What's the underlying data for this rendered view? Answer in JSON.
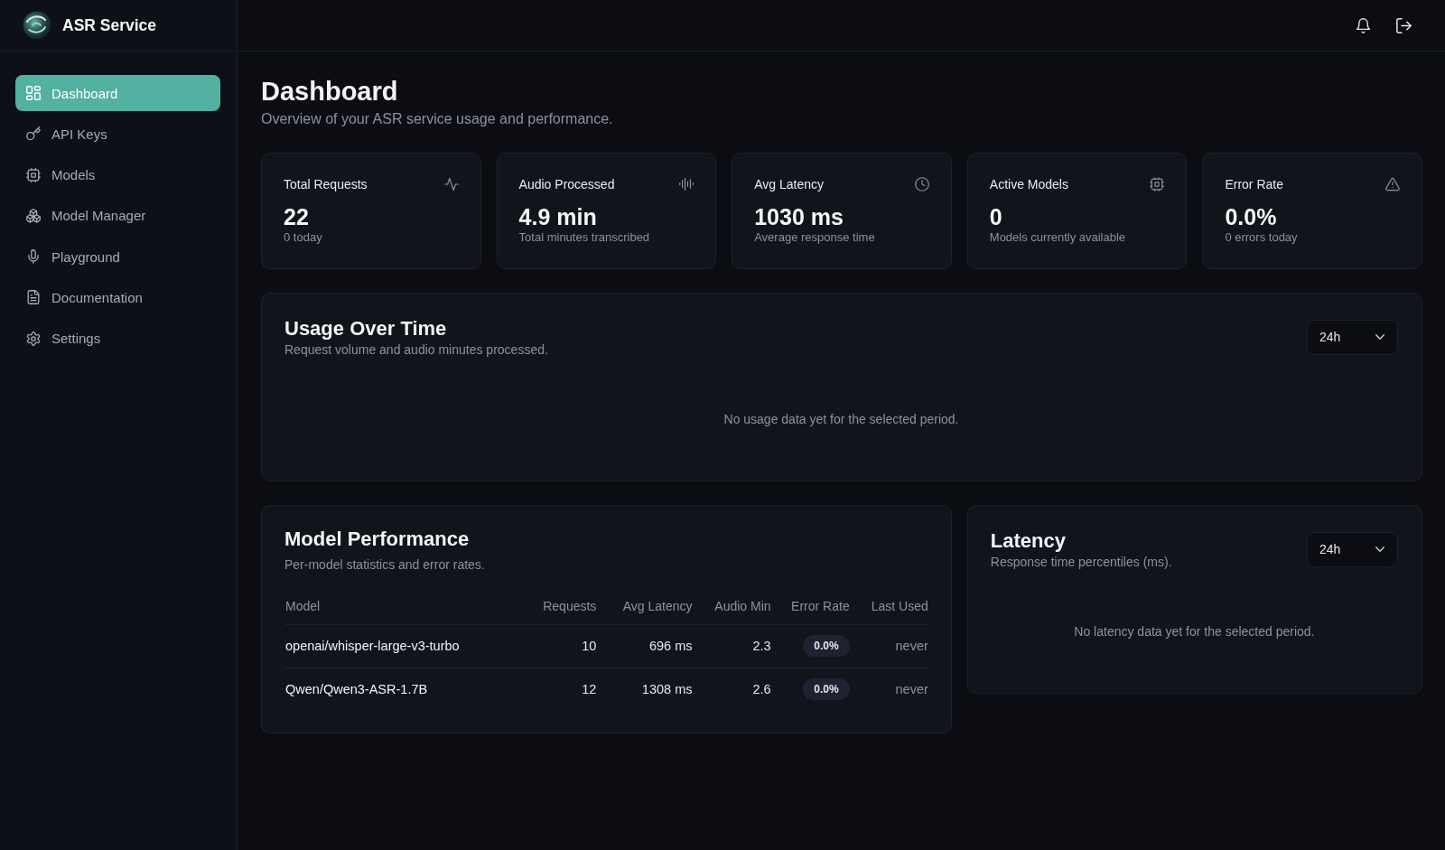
{
  "sidebar": {
    "brand": "ASR Service",
    "items": [
      {
        "label": "Dashboard",
        "selected": true
      },
      {
        "label": "API Keys",
        "selected": false
      },
      {
        "label": "Models",
        "selected": false
      },
      {
        "label": "Model Manager",
        "selected": false
      },
      {
        "label": "Playground",
        "selected": false
      },
      {
        "label": "Documentation",
        "selected": false
      },
      {
        "label": "Settings",
        "selected": false
      }
    ]
  },
  "page": {
    "title": "Dashboard",
    "subtitle": "Overview of your ASR service usage and performance."
  },
  "stats": [
    {
      "label": "Total Requests",
      "value": "22",
      "note": "0 today"
    },
    {
      "label": "Audio Processed",
      "value": "4.9 min",
      "note": "Total minutes transcribed"
    },
    {
      "label": "Avg Latency",
      "value": "1030 ms",
      "note": "Average response time"
    },
    {
      "label": "Active Models",
      "value": "0",
      "note": "Models currently available"
    },
    {
      "label": "Error Rate",
      "value": "0.0%",
      "note": "0 errors today"
    }
  ],
  "usage": {
    "title": "Usage Over Time",
    "subtitle": "Request volume and audio minutes processed.",
    "range": "24h",
    "empty_message": "No usage data yet for the selected period."
  },
  "model_performance": {
    "title": "Model Performance",
    "subtitle": "Per-model statistics and error rates.",
    "columns": [
      "Model",
      "Requests",
      "Avg Latency",
      "Audio Min",
      "Error Rate",
      "Last Used"
    ],
    "rows": [
      [
        "openai/whisper-large-v3-turbo",
        "10",
        "696 ms",
        "2.3",
        "0.0%",
        "never"
      ],
      [
        "Qwen/Qwen3-ASR-1.7B",
        "12",
        "1308 ms",
        "2.6",
        "0.0%",
        "never"
      ]
    ]
  },
  "latency": {
    "title": "Latency",
    "subtitle": "Response time percentiles (ms).",
    "range": "24h",
    "empty_message": "No latency data yet for the selected period."
  }
}
